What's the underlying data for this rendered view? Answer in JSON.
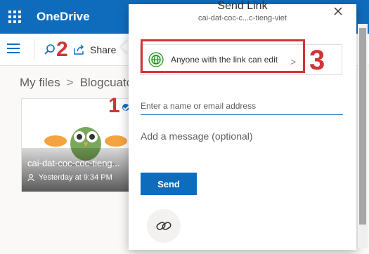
{
  "app": {
    "name": "OneDrive"
  },
  "toolbar": {
    "share_label": "Share"
  },
  "breadcrumb": {
    "items": [
      "My files",
      "Blogcuato"
    ]
  },
  "file": {
    "name": "cai-dat-coc-coc-tieng...",
    "modified": "Yesterday at 9:34 PM"
  },
  "dialog": {
    "title": "Send Link",
    "subtitle": "cai-dat-coc-c...c-tieng-viet",
    "permission_label": "Anyone with the link can edit",
    "to_placeholder": "Enter a name or email address",
    "message_placeholder": "Add a message (optional)",
    "send_label": "Send"
  },
  "annotations": {
    "marker_1": "1",
    "marker_2": "2",
    "marker_3": "3"
  },
  "colors": {
    "brand": "#0f6cbd",
    "annotation": "#d13438",
    "header_text": "#ffffff"
  },
  "icons": [
    "app-launcher-icon",
    "hamburger-menu-icon",
    "search-icon",
    "share-icon",
    "checkmark-icon",
    "people-icon",
    "close-icon",
    "globe-icon",
    "chevron-right-icon",
    "link-icon"
  ]
}
